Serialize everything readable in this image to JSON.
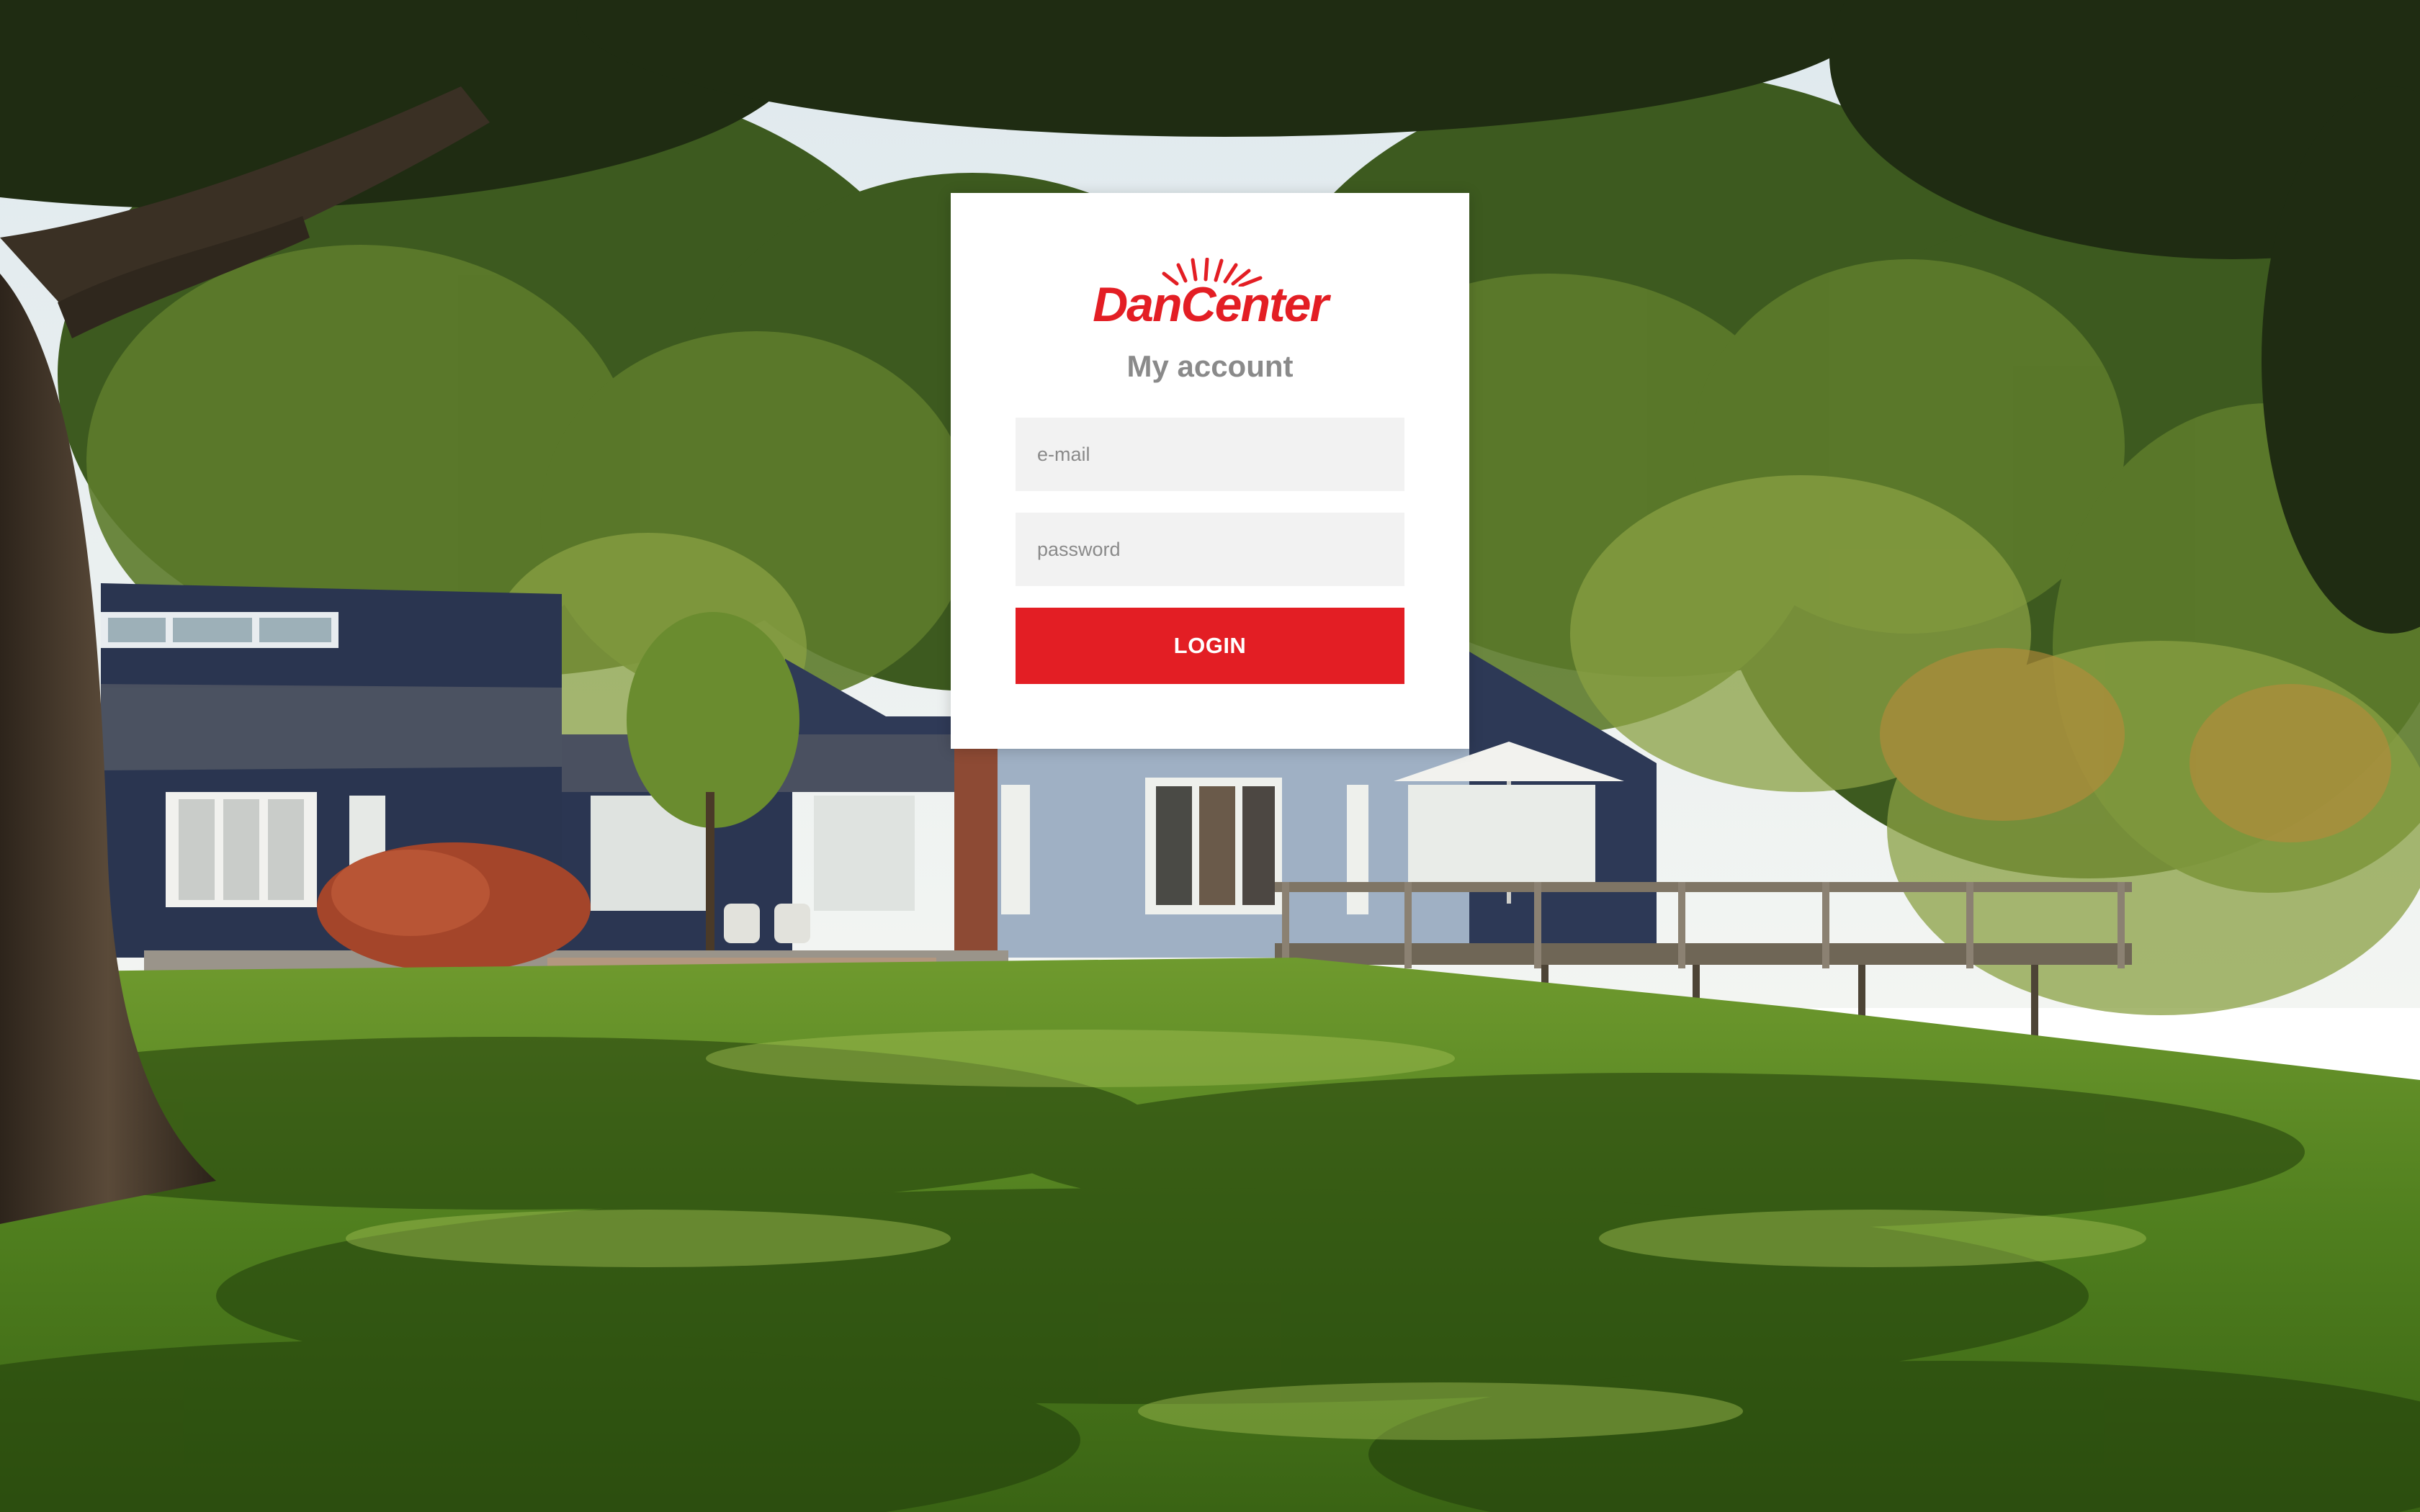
{
  "brand": {
    "name": "DanCenter",
    "accent_color": "#e31e24"
  },
  "card": {
    "title": "My account"
  },
  "form": {
    "email_placeholder": "e-mail",
    "password_placeholder": "password",
    "login_label": "LOGIN"
  },
  "icons": {
    "logo_sunburst": "sunburst-icon"
  }
}
